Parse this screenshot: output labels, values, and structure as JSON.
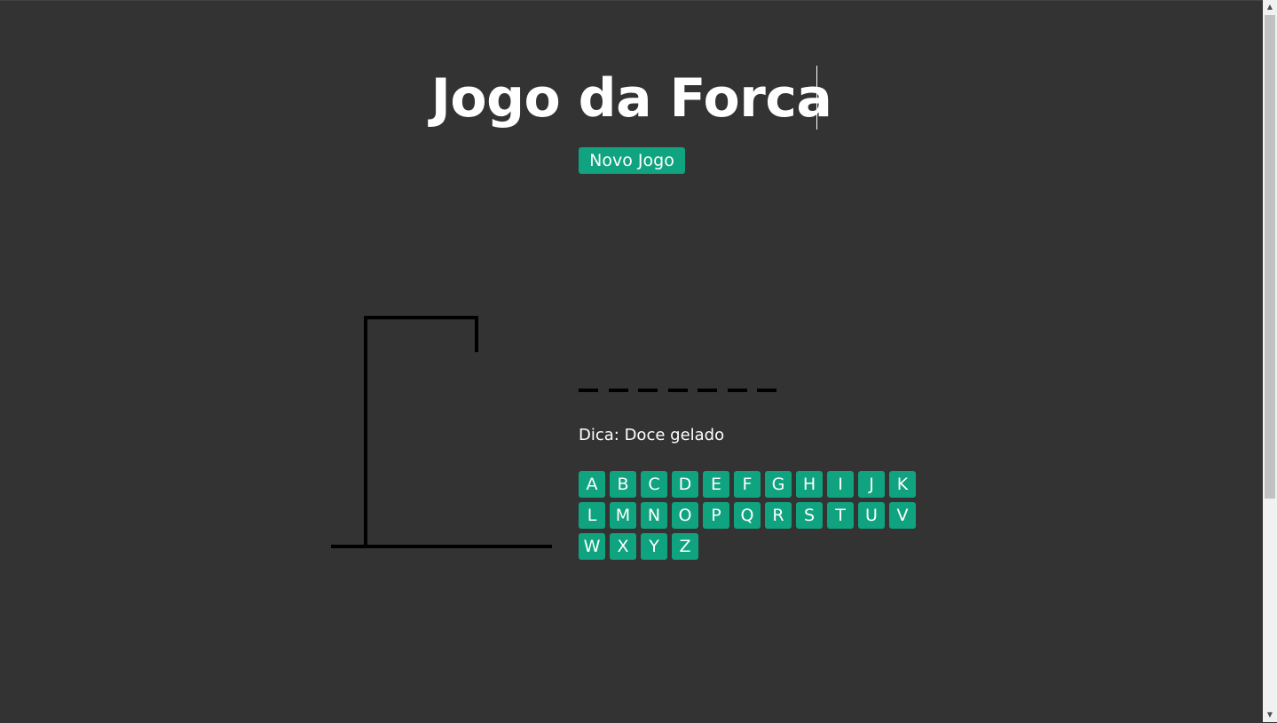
{
  "header": {
    "title": "Jogo da Forca",
    "new_game_label": "Novo Jogo"
  },
  "game": {
    "word_length": 7,
    "hint": "Dica: Doce gelado",
    "errors": 0,
    "letters": [
      "A",
      "B",
      "C",
      "D",
      "E",
      "F",
      "G",
      "H",
      "I",
      "J",
      "K",
      "L",
      "M",
      "N",
      "O",
      "P",
      "Q",
      "R",
      "S",
      "T",
      "U",
      "V",
      "W",
      "X",
      "Y",
      "Z"
    ]
  },
  "colors": {
    "background": "#333333",
    "accent": "#10a37f",
    "text": "#ffffff",
    "gallows": "#000000"
  },
  "scrollbar": {
    "up_icon": "scroll-up-arrow-icon",
    "down_icon": "scroll-down-arrow-icon"
  }
}
